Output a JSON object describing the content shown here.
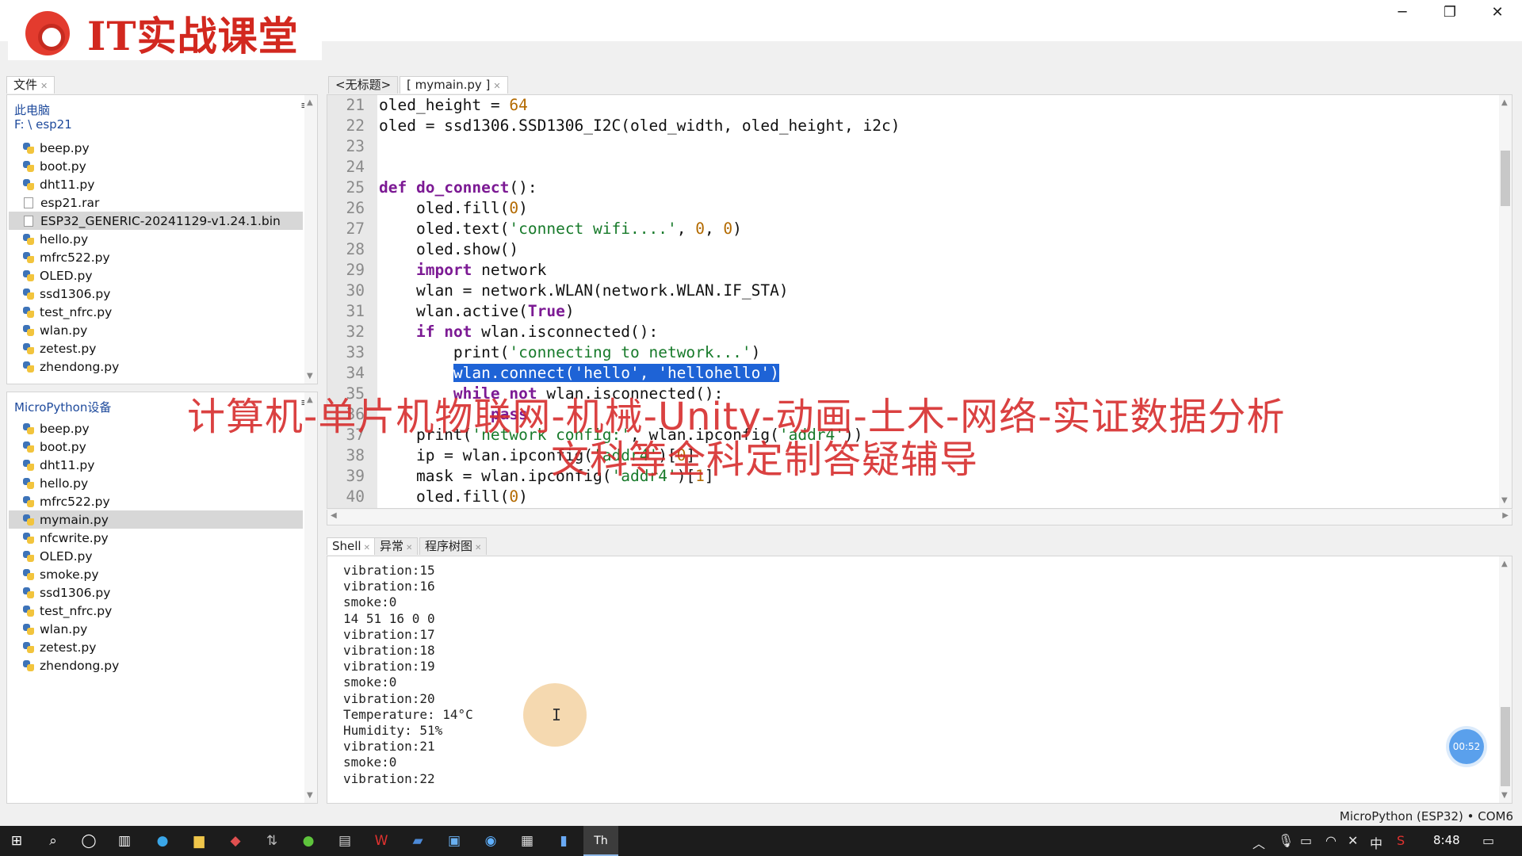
{
  "app": {
    "logo_text": "IT实战课堂",
    "window_controls": {
      "minimize": "─",
      "restore": "❐",
      "close": "✕"
    }
  },
  "files_tab": {
    "label": "文件"
  },
  "local_files": {
    "title": "此电脑",
    "path": "F: \\ esp21",
    "items": [
      {
        "name": "beep.py",
        "icon": "python-file-icon"
      },
      {
        "name": "boot.py",
        "icon": "python-file-icon"
      },
      {
        "name": "dht11.py",
        "icon": "python-file-icon"
      },
      {
        "name": "esp21.rar",
        "icon": "generic-file-icon"
      },
      {
        "name": "ESP32_GENERIC-20241129-v1.24.1.bin",
        "icon": "generic-file-icon",
        "selected": true
      },
      {
        "name": "hello.py",
        "icon": "python-file-icon"
      },
      {
        "name": "mfrc522.py",
        "icon": "python-file-icon"
      },
      {
        "name": "OLED.py",
        "icon": "python-file-icon"
      },
      {
        "name": "ssd1306.py",
        "icon": "python-file-icon"
      },
      {
        "name": "test_nfrc.py",
        "icon": "python-file-icon"
      },
      {
        "name": "wlan.py",
        "icon": "python-file-icon"
      },
      {
        "name": "zetest.py",
        "icon": "python-file-icon"
      },
      {
        "name": "zhendong.py",
        "icon": "python-file-icon"
      }
    ]
  },
  "device_files": {
    "title": "MicroPython设备",
    "items": [
      {
        "name": "beep.py"
      },
      {
        "name": "boot.py"
      },
      {
        "name": "dht11.py"
      },
      {
        "name": "hello.py"
      },
      {
        "name": "mfrc522.py"
      },
      {
        "name": "mymain.py",
        "selected": true
      },
      {
        "name": "nfcwrite.py"
      },
      {
        "name": "OLED.py"
      },
      {
        "name": "smoke.py"
      },
      {
        "name": "ssd1306.py"
      },
      {
        "name": "test_nfrc.py"
      },
      {
        "name": "wlan.py"
      },
      {
        "name": "zetest.py"
      },
      {
        "name": "zhendong.py"
      }
    ]
  },
  "editor": {
    "tabs": [
      {
        "label": "<无标题>"
      },
      {
        "label": "[ mymain.py ]"
      }
    ],
    "lines": [
      {
        "n": "21",
        "t": [
          [
            "",
            "oled_height = "
          ],
          [
            "num",
            "64"
          ]
        ]
      },
      {
        "n": "22",
        "t": [
          [
            "",
            "oled = ssd1306.SSD1306_I2C(oled_width, oled_height, i2c)"
          ]
        ]
      },
      {
        "n": "23",
        "t": []
      },
      {
        "n": "24",
        "t": []
      },
      {
        "n": "25",
        "t": [
          [
            "kw",
            "def"
          ],
          [
            "",
            " "
          ],
          [
            "kw",
            "do_connect"
          ],
          [
            "",
            "():"
          ]
        ]
      },
      {
        "n": "26",
        "t": [
          [
            "",
            "    oled.fill("
          ],
          [
            "num",
            "0"
          ],
          [
            "",
            ")"
          ]
        ]
      },
      {
        "n": "27",
        "t": [
          [
            "",
            "    oled.text("
          ],
          [
            "str",
            "'connect wifi....'"
          ],
          [
            "",
            ", "
          ],
          [
            "num",
            "0"
          ],
          [
            "",
            ", "
          ],
          [
            "num",
            "0"
          ],
          [
            "",
            ")"
          ]
        ]
      },
      {
        "n": "28",
        "t": [
          [
            "",
            "    oled.show()"
          ]
        ]
      },
      {
        "n": "29",
        "t": [
          [
            "",
            "    "
          ],
          [
            "kw",
            "import"
          ],
          [
            "",
            " network"
          ]
        ]
      },
      {
        "n": "30",
        "t": [
          [
            "",
            "    wlan = network.WLAN(network.WLAN.IF_STA)"
          ]
        ]
      },
      {
        "n": "31",
        "t": [
          [
            "",
            "    wlan.active("
          ],
          [
            "kw",
            "True"
          ],
          [
            "",
            ")"
          ]
        ]
      },
      {
        "n": "32",
        "t": [
          [
            "",
            "    "
          ],
          [
            "kw",
            "if"
          ],
          [
            "",
            " "
          ],
          [
            "kw",
            "not"
          ],
          [
            "",
            " wlan.isconnected():"
          ]
        ]
      },
      {
        "n": "33",
        "t": [
          [
            "",
            "        print("
          ],
          [
            "str",
            "'connecting to network...'"
          ],
          [
            "",
            ")"
          ]
        ]
      },
      {
        "n": "34",
        "t": [
          [
            "",
            "        "
          ],
          [
            "hl",
            "wlan.connect('hello', 'hellohello')"
          ]
        ]
      },
      {
        "n": "35",
        "t": [
          [
            "",
            "        "
          ],
          [
            "kw",
            "while"
          ],
          [
            "",
            " "
          ],
          [
            "kw",
            "not"
          ],
          [
            "",
            " wlan.isconnected():"
          ]
        ]
      },
      {
        "n": "36",
        "t": [
          [
            "",
            "            "
          ],
          [
            "kw",
            "pass"
          ]
        ]
      },
      {
        "n": "37",
        "t": [
          [
            "",
            "    print("
          ],
          [
            "str",
            "'network config:'"
          ],
          [
            "",
            ", wlan.ipconfig("
          ],
          [
            "str",
            "'addr4'"
          ],
          [
            "",
            "))"
          ]
        ]
      },
      {
        "n": "38",
        "t": [
          [
            "",
            "    ip = wlan.ipconfig("
          ],
          [
            "str",
            "'addr4'"
          ],
          [
            "",
            ")["
          ],
          [
            "num",
            "0"
          ],
          [
            "",
            "]"
          ]
        ]
      },
      {
        "n": "39",
        "t": [
          [
            "",
            "    mask = wlan.ipconfig("
          ],
          [
            "str",
            "'addr4'"
          ],
          [
            "",
            ")["
          ],
          [
            "num",
            "1"
          ],
          [
            "",
            "]"
          ]
        ]
      },
      {
        "n": "40",
        "t": [
          [
            "",
            "    oled.fill("
          ],
          [
            "num",
            "0"
          ],
          [
            "",
            ")"
          ]
        ]
      }
    ]
  },
  "shell": {
    "tabs": [
      {
        "label": "Shell"
      },
      {
        "label": "异常"
      },
      {
        "label": "程序树图"
      }
    ],
    "lines": [
      "vibration:15",
      "vibration:16",
      "smoke:0",
      "14 51 16 0 0",
      "vibration:17",
      "vibration:18",
      "vibration:19",
      "smoke:0",
      "vibration:20",
      "Temperature: 14°C",
      "Humidity: 51%",
      "vibration:21",
      "smoke:0",
      "vibration:22"
    ],
    "timer": "00:52"
  },
  "status": {
    "interpreter": "MicroPython (ESP32)  •  COM6"
  },
  "overlay": {
    "line1": "计算机-单片机物联网-机械-Unity-动画-土木-网络-实证数据分析",
    "line2": "文科等全科定制答疑辅导"
  },
  "taskbar": {
    "icons": [
      "windows-start-icon",
      "search-icon",
      "cortana-icon",
      "task-view-icon",
      "edge-icon",
      "file-explorer-icon",
      "app-icon-1",
      "app-icon-2",
      "app-icon-3",
      "app-icon-4",
      "wps-icon",
      "app-icon-5",
      "app-icon-6",
      "app-icon-7",
      "app-icon-8",
      "notepad-icon",
      "thonny-icon"
    ],
    "tray": {
      "input_method": "中",
      "clock": "8:48"
    }
  },
  "colors": {
    "keyword": "#7c1a94",
    "number": "#b36a00",
    "string": "#177a2a",
    "selection": "#1e63d6",
    "overlay_text": "#d62c2c",
    "logo_red": "#d2281f"
  }
}
